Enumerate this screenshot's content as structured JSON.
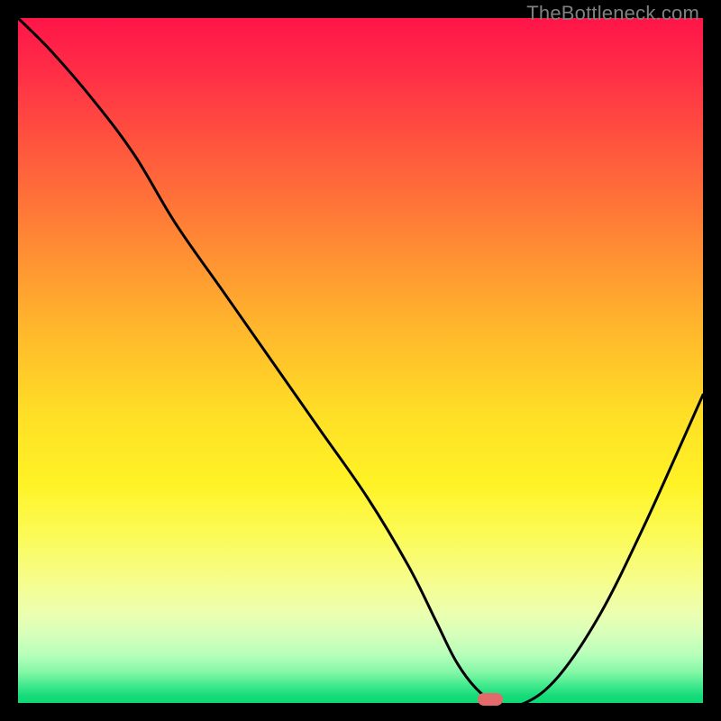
{
  "watermark": "TheBottleneck.com",
  "colors": {
    "curve": "#000000",
    "marker": "#e26a6a",
    "frame_bg": "#000000"
  },
  "chart_data": {
    "type": "line",
    "title": "",
    "xlabel": "",
    "ylabel": "",
    "xlim": [
      0,
      100
    ],
    "ylim": [
      0,
      100
    ],
    "grid": false,
    "legend": false,
    "series": [
      {
        "name": "bottleneck-curve",
        "x": [
          0,
          5,
          11,
          17,
          23,
          30,
          37,
          44,
          51,
          57,
          61,
          64,
          67,
          70,
          74,
          79,
          85,
          91,
          96,
          100
        ],
        "values": [
          100,
          95,
          88,
          80,
          70,
          60,
          50,
          40,
          30,
          20,
          12,
          6,
          2,
          0,
          0,
          4,
          13,
          25,
          36,
          45
        ]
      }
    ],
    "annotations": [
      {
        "name": "optimal-marker",
        "x": 69,
        "y": 0.5
      }
    ]
  }
}
